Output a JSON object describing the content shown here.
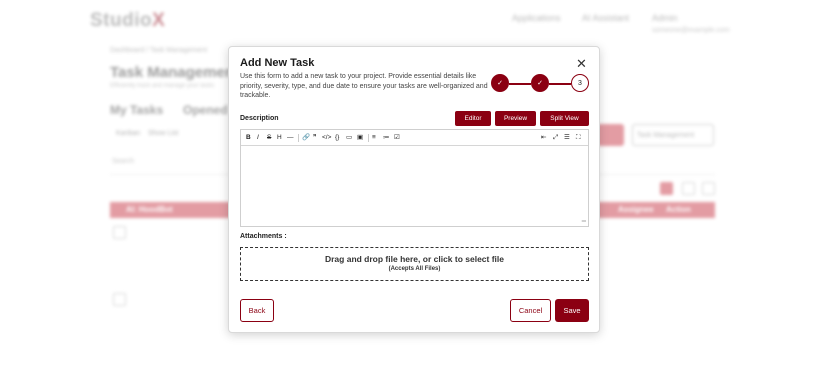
{
  "background": {
    "logo_text": "Studio",
    "logo_accent": "X",
    "nav": [
      "Applications",
      "AI Assistant",
      "Admin"
    ],
    "user_sub": "someone@example.com",
    "breadcrumb": "Dashboard / Task Management",
    "page_title": "Task Management",
    "page_desc": "Efficiently track and manage your tasks",
    "tabs": [
      "My Tasks",
      "Opened"
    ],
    "chips": [
      "Kanban",
      "Show List"
    ],
    "select_label": "Task Management",
    "search_placeholder": "Search",
    "row_group_label": "AI: HoodBot",
    "columns": [
      "Assignee",
      "Action"
    ],
    "accent_color": "#8b0012"
  },
  "modal": {
    "title": "Add New Task",
    "description": "Use this form to add a new task to your project. Provide essential details like priority, severity, type, and due date to ensure your tasks are well-organized and trackable.",
    "steps": [
      {
        "label": "✓",
        "state": "done"
      },
      {
        "label": "✓",
        "state": "done"
      },
      {
        "label": "3",
        "state": "current"
      }
    ],
    "description_label": "Description",
    "view_buttons": [
      "Editor",
      "Preview",
      "Split View"
    ],
    "toolbar": {
      "bold": "B",
      "italic": "I",
      "strike": "S",
      "heading": "H",
      "hr": "—",
      "link": "🔗",
      "quote": "❞",
      "code": "</>",
      "code_block": "{}",
      "comment": "▭",
      "image": "▣",
      "ul": "≡",
      "ol": "≔",
      "task": "☑",
      "outdent": "⇤",
      "fullscreen": "⤢",
      "toc": "☰",
      "expand": "⛶"
    },
    "editor_text": "",
    "attachments_label": "Attachments :",
    "drop_text": "Drag and drop file here, or click to select file",
    "drop_subtext": "(Accepts All Files)",
    "back_label": "Back",
    "cancel_label": "Cancel",
    "save_label": "Save"
  }
}
